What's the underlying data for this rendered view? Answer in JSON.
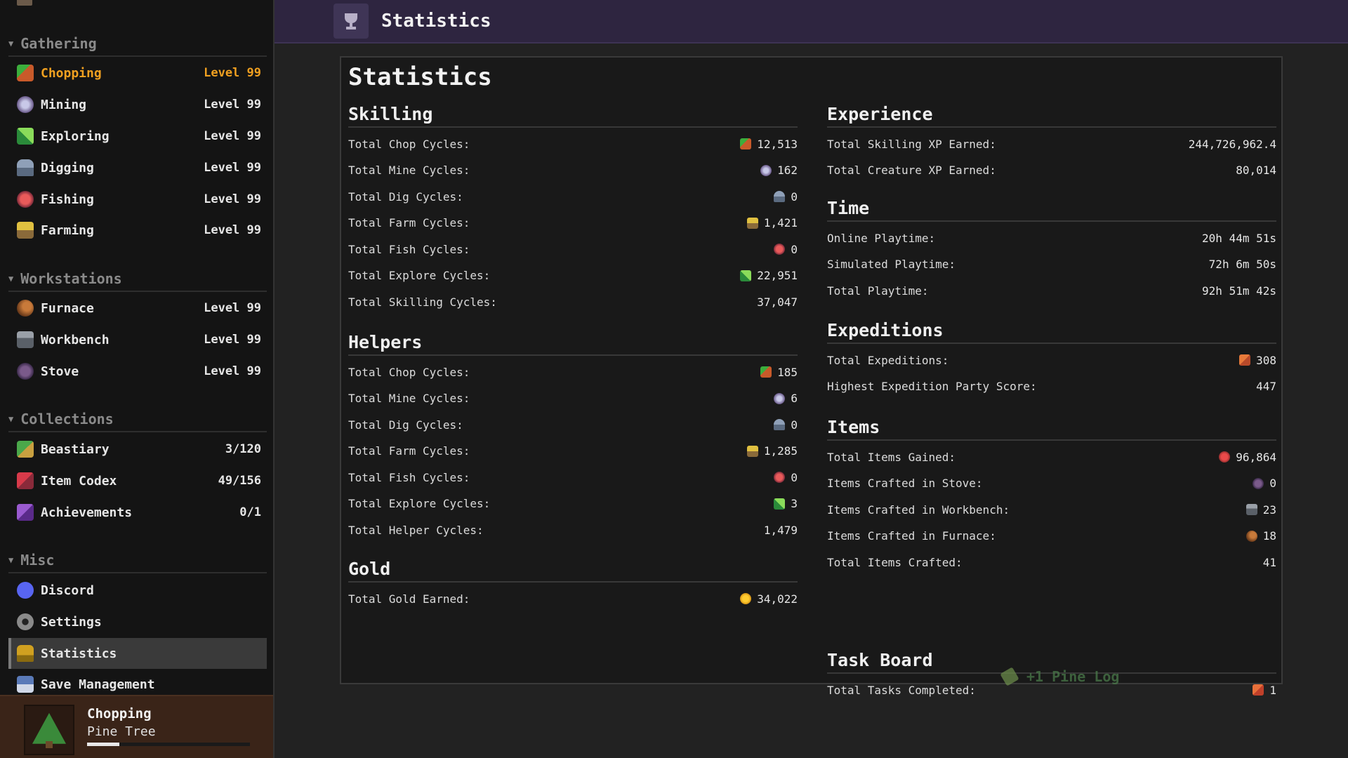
{
  "sidebar": {
    "sections": [
      {
        "title": "Gathering",
        "items": [
          {
            "label": "Chopping",
            "value": "Level 99",
            "icon": "axe-icon",
            "active": true
          },
          {
            "label": "Mining",
            "value": "Level 99",
            "icon": "pickaxe-icon"
          },
          {
            "label": "Exploring",
            "value": "Level 99",
            "icon": "compass-icon"
          },
          {
            "label": "Digging",
            "value": "Level 99",
            "icon": "shovel-icon"
          },
          {
            "label": "Fishing",
            "value": "Level 99",
            "icon": "fish-icon"
          },
          {
            "label": "Farming",
            "value": "Level 99",
            "icon": "wheat-icon"
          }
        ]
      },
      {
        "title": "Workstations",
        "items": [
          {
            "label": "Furnace",
            "value": "Level 99",
            "icon": "furnace-icon"
          },
          {
            "label": "Workbench",
            "value": "Level 99",
            "icon": "anvil-icon"
          },
          {
            "label": "Stove",
            "value": "Level 99",
            "icon": "stove-icon"
          }
        ]
      },
      {
        "title": "Collections",
        "items": [
          {
            "label": "Beastiary",
            "value": "3/120",
            "icon": "book-icon"
          },
          {
            "label": "Item Codex",
            "value": "49/156",
            "icon": "codex-icon"
          },
          {
            "label": "Achievements",
            "value": "0/1",
            "icon": "achievement-icon"
          }
        ]
      },
      {
        "title": "Misc",
        "items": [
          {
            "label": "Discord",
            "value": "",
            "icon": "discord-icon"
          },
          {
            "label": "Settings",
            "value": "",
            "icon": "gear-icon"
          },
          {
            "label": "Statistics",
            "value": "",
            "icon": "trophy-icon",
            "selected": true
          },
          {
            "label": "Save Management",
            "value": "",
            "icon": "save-icon"
          }
        ]
      }
    ]
  },
  "current_action": {
    "title": "Chopping",
    "target": "Pine Tree",
    "progress": 0.2
  },
  "header": {
    "title": "Statistics",
    "icon": "trophy-icon"
  },
  "panel": {
    "title": "Statistics",
    "left_sections": [
      {
        "title": "Skilling",
        "rows": [
          {
            "label": "Total Chop Cycles:",
            "value": "12,513",
            "icon": "chop"
          },
          {
            "label": "Total Mine Cycles:",
            "value": "162",
            "icon": "mine"
          },
          {
            "label": "Total Dig Cycles:",
            "value": "0",
            "icon": "dig"
          },
          {
            "label": "Total Farm Cycles:",
            "value": "1,421",
            "icon": "farm"
          },
          {
            "label": "Total Fish Cycles:",
            "value": "0",
            "icon": "fish"
          },
          {
            "label": "Total Explore Cycles:",
            "value": "22,951",
            "icon": "explore"
          },
          {
            "label": "Total Skilling Cycles:",
            "value": "37,047",
            "icon": ""
          }
        ]
      },
      {
        "title": "Helpers",
        "rows": [
          {
            "label": "Total Chop Cycles:",
            "value": "185",
            "icon": "chop"
          },
          {
            "label": "Total Mine Cycles:",
            "value": "6",
            "icon": "mine"
          },
          {
            "label": "Total Dig Cycles:",
            "value": "0",
            "icon": "dig"
          },
          {
            "label": "Total Farm Cycles:",
            "value": "1,285",
            "icon": "farm"
          },
          {
            "label": "Total Fish Cycles:",
            "value": "0",
            "icon": "fish"
          },
          {
            "label": "Total Explore Cycles:",
            "value": "3",
            "icon": "explore"
          },
          {
            "label": "Total Helper Cycles:",
            "value": "1,479",
            "icon": ""
          }
        ]
      },
      {
        "title": "Gold",
        "rows": [
          {
            "label": "Total Gold Earned:",
            "value": "34,022",
            "icon": "gold"
          }
        ]
      }
    ],
    "right_sections": [
      {
        "title": "Experience",
        "rows": [
          {
            "label": "Total Skilling XP Earned:",
            "value": "244,726,962.4",
            "icon": ""
          },
          {
            "label": "Total Creature XP Earned:",
            "value": "80,014",
            "icon": ""
          }
        ]
      },
      {
        "title": "Time",
        "rows": [
          {
            "label": "Online Playtime:",
            "value": "20h 44m 51s",
            "icon": ""
          },
          {
            "label": "Simulated Playtime:",
            "value": "72h 6m 50s",
            "icon": ""
          },
          {
            "label": "Total Playtime:",
            "value": "92h 51m 42s",
            "icon": ""
          }
        ]
      },
      {
        "title": "Expeditions",
        "rows": [
          {
            "label": "Total Expeditions:",
            "value": "308",
            "icon": "expedition"
          },
          {
            "label": "Highest Expedition Party Score:",
            "value": "447",
            "icon": ""
          }
        ]
      },
      {
        "title": "Items",
        "rows": [
          {
            "label": "Total Items Gained:",
            "value": "96,864",
            "icon": "items"
          },
          {
            "label": "Items Crafted in Stove:",
            "value": "0",
            "icon": "stove"
          },
          {
            "label": "Items Crafted in Workbench:",
            "value": "23",
            "icon": "workbench"
          },
          {
            "label": "Items Crafted in Furnace:",
            "value": "18",
            "icon": "furnace"
          },
          {
            "label": "Total Items Crafted:",
            "value": "41",
            "icon": ""
          }
        ]
      },
      {
        "title": "Task Board",
        "rows": [
          {
            "label": "Total Tasks Completed:",
            "value": "1",
            "icon": "task"
          }
        ]
      }
    ]
  },
  "floating_popup": {
    "text": "+1 Pine Log",
    "icon": "log-icon"
  }
}
